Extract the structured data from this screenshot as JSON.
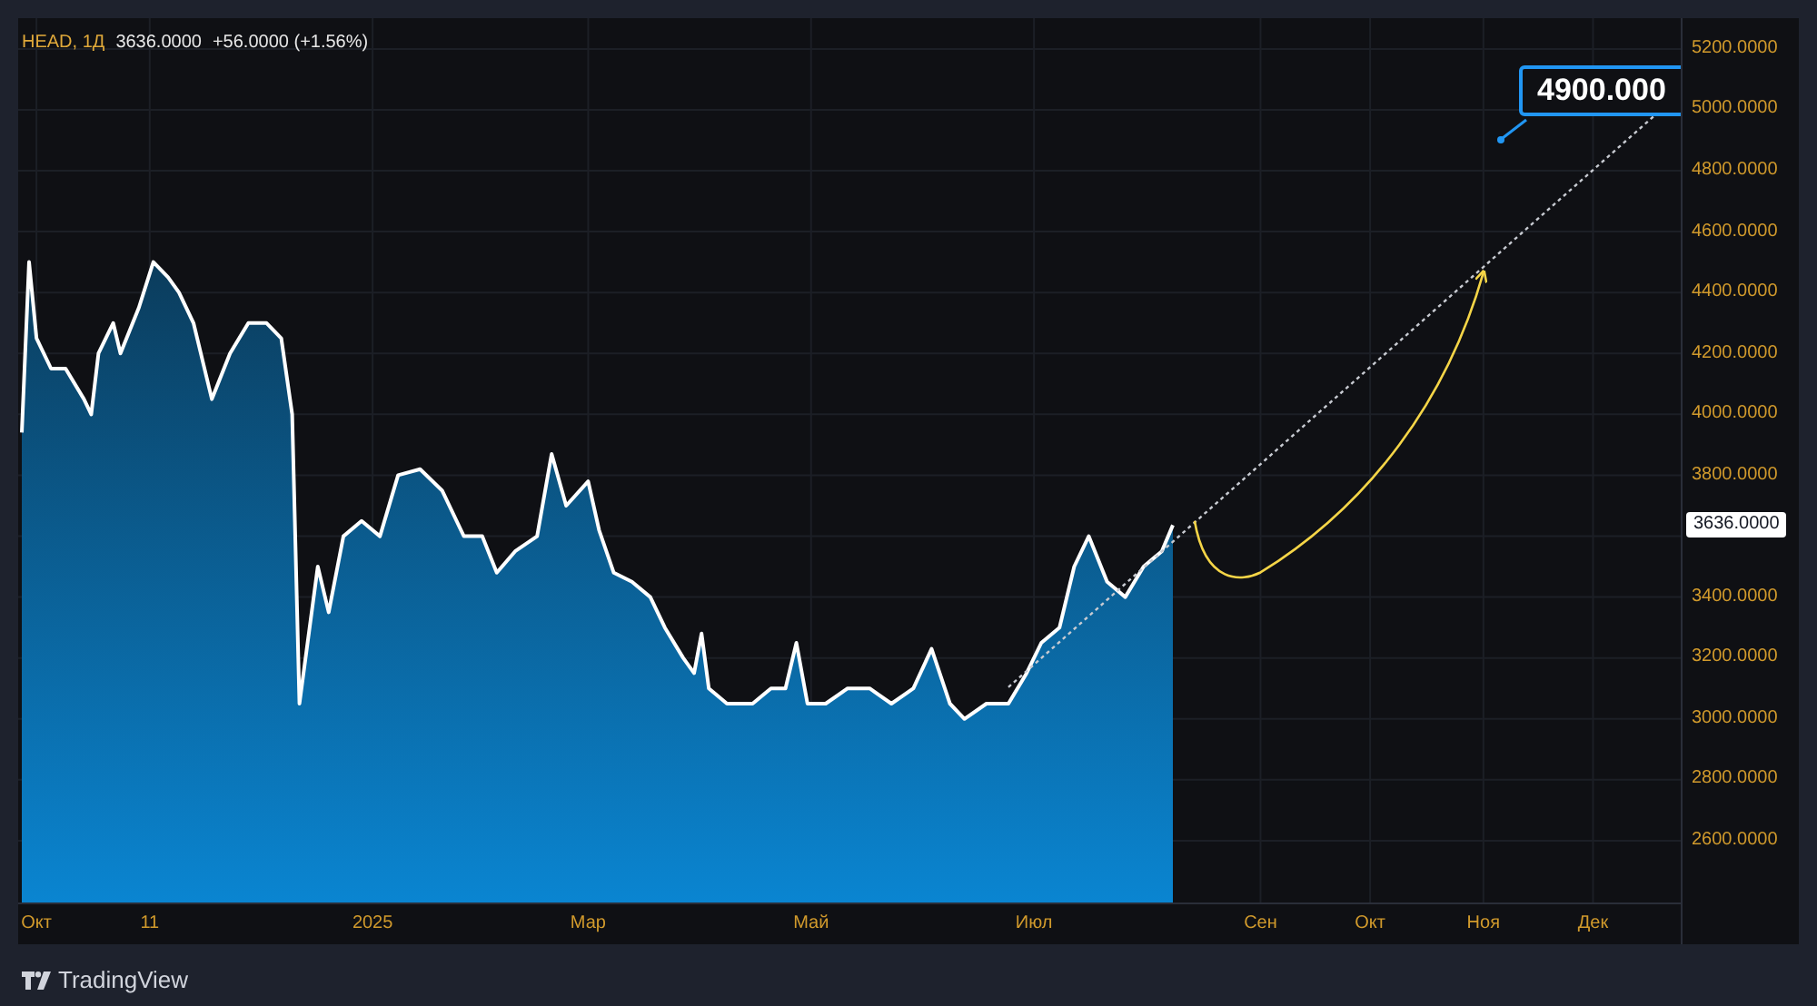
{
  "header": {
    "symbol": "HEAD, 1Д",
    "price": "3636.0000",
    "change": "+56.0000 (+1.56%)"
  },
  "chart": {
    "price_label": "3636.0000",
    "callout": {
      "text": "4900.000"
    },
    "chart_data": {
      "type": "area",
      "grid": true,
      "xlim": [
        "2024-09-26",
        "2025-12-25"
      ],
      "ylim": [
        2397,
        5301
      ],
      "x": [
        "2024-09-27",
        "2024-09-29",
        "2024-10-01",
        "2024-10-05",
        "2024-10-09",
        "2024-10-14",
        "2024-10-16",
        "2024-10-18",
        "2024-10-22",
        "2024-10-24",
        "2024-10-29",
        "2024-11-02",
        "2024-11-06",
        "2024-11-09",
        "2024-11-13",
        "2024-11-18",
        "2024-11-23",
        "2024-11-28",
        "2024-12-03",
        "2024-12-07",
        "2024-12-10",
        "2024-12-12",
        "2024-12-17",
        "2024-12-20",
        "2024-12-24",
        "2024-12-29",
        "2025-01-03",
        "2025-01-08",
        "2025-01-14",
        "2025-01-20",
        "2025-01-26",
        "2025-01-31",
        "2025-02-04",
        "2025-02-09",
        "2025-02-15",
        "2025-02-19",
        "2025-02-23",
        "2025-03-01",
        "2025-03-04",
        "2025-03-08",
        "2025-03-13",
        "2025-03-18",
        "2025-03-22",
        "2025-03-27",
        "2025-03-30",
        "2025-04-01",
        "2025-04-03",
        "2025-04-08",
        "2025-04-11",
        "2025-04-15",
        "2025-04-20",
        "2025-04-24",
        "2025-04-27",
        "2025-04-30",
        "2025-05-05",
        "2025-05-11",
        "2025-05-17",
        "2025-05-23",
        "2025-05-29",
        "2025-06-03",
        "2025-06-08",
        "2025-06-12",
        "2025-06-18",
        "2025-06-24",
        "2025-06-29",
        "2025-07-03",
        "2025-07-08",
        "2025-07-12",
        "2025-07-16",
        "2025-07-21",
        "2025-07-26",
        "2025-07-31",
        "2025-08-05",
        "2025-08-08"
      ],
      "series": [
        {
          "color": "#ffffff",
          "values": [
            3940,
            4500,
            4250,
            4150,
            4150,
            4050,
            4000,
            4200,
            4300,
            4200,
            4350,
            4500,
            4450,
            4400,
            4300,
            4050,
            4200,
            4300,
            4300,
            4250,
            4000,
            3050,
            3500,
            3350,
            3600,
            3650,
            3600,
            3800,
            3820,
            3750,
            3600,
            3600,
            3480,
            3550,
            3600,
            3870,
            3700,
            3780,
            3620,
            3480,
            3450,
            3400,
            3300,
            3200,
            3150,
            3280,
            3100,
            3050,
            3050,
            3050,
            3100,
            3100,
            3250,
            3050,
            3050,
            3100,
            3100,
            3050,
            3100,
            3230,
            3050,
            3000,
            3050,
            3050,
            3150,
            3250,
            3300,
            3500,
            3600,
            3450,
            3400,
            3500,
            3550,
            3636
          ]
        }
      ],
      "xticks": [
        {
          "value": "2024-10-01",
          "label": "Окт"
        },
        {
          "value": "2024-11-01",
          "label": "11"
        },
        {
          "value": "2025-01-01",
          "label": "2025"
        },
        {
          "value": "2025-03-01",
          "label": "Мар"
        },
        {
          "value": "2025-05-01",
          "label": "Май"
        },
        {
          "value": "2025-07-01",
          "label": "Июл"
        },
        {
          "value": "2025-09-01",
          "label": "Сен"
        },
        {
          "value": "2025-10-01",
          "label": "Окт"
        },
        {
          "value": "2025-11-01",
          "label": "Ноя"
        },
        {
          "value": "2025-12-01",
          "label": "Дек"
        }
      ],
      "yticks": [
        {
          "value": 2600,
          "label": "2600.0000"
        },
        {
          "value": 2800,
          "label": "2800.0000"
        },
        {
          "value": 3000,
          "label": "3000.0000"
        },
        {
          "value": 3200,
          "label": "3200.0000"
        },
        {
          "value": 3400,
          "label": "3400.0000"
        },
        {
          "value": 3800,
          "label": "3800.0000"
        },
        {
          "value": 4000,
          "label": "4000.0000"
        },
        {
          "value": 4200,
          "label": "4200.0000"
        },
        {
          "value": 4400,
          "label": "4400.0000"
        },
        {
          "value": 4600,
          "label": "4600.0000"
        },
        {
          "value": 4800,
          "label": "4800.0000"
        },
        {
          "value": 5000,
          "label": "5000.0000"
        },
        {
          "value": 5200,
          "label": "5200.0000"
        }
      ]
    }
  },
  "footer": {
    "brand": "TradingView"
  }
}
